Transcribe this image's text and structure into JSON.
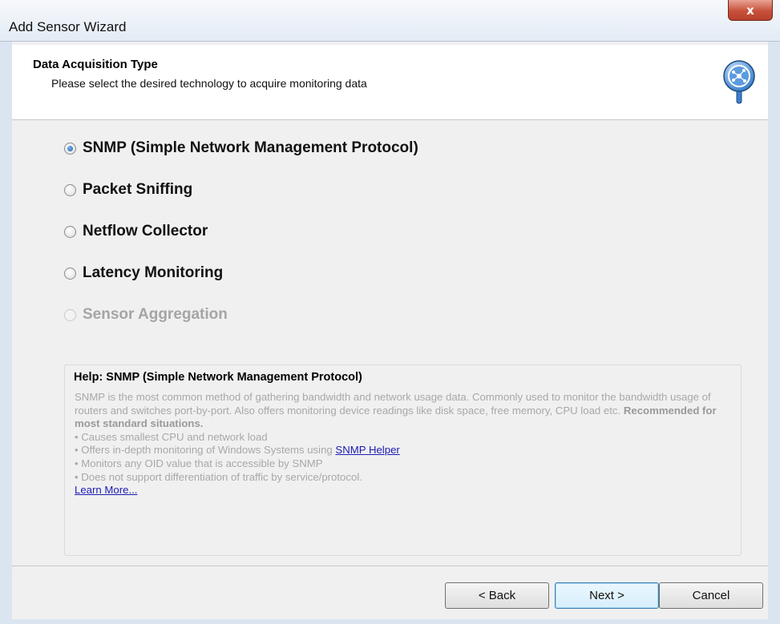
{
  "window": {
    "title": "Add Sensor Wizard",
    "close_label": "x"
  },
  "header": {
    "title": "Data Acquisition Type",
    "subtitle": "Please select the desired technology to acquire monitoring data",
    "icon": "sensor-wizard-icon"
  },
  "options": [
    {
      "label": "SNMP (Simple Network Management Protocol)",
      "checked": true,
      "disabled": false
    },
    {
      "label": "Packet Sniffing",
      "checked": false,
      "disabled": false
    },
    {
      "label": "Netflow Collector",
      "checked": false,
      "disabled": false
    },
    {
      "label": "Latency Monitoring",
      "checked": false,
      "disabled": false
    },
    {
      "label": "Sensor Aggregation",
      "checked": false,
      "disabled": true
    }
  ],
  "help": {
    "title": "Help: SNMP (Simple Network Management Protocol)",
    "intro": "SNMP is the most common method of gathering bandwidth and network usage data. Commonly used to monitor the bandwidth usage of routers and switches port-by-port. Also offers monitoring device readings like disk space, free memory, CPU load etc.",
    "intro_bold": "Recommended for most standard situations.",
    "bullet_1": "Causes smallest CPU and network load",
    "bullet_2_prefix": "Offers in-depth monitoring of Windows Systems using",
    "bullet_2_link": "SNMP Helper",
    "bullet_3": "Monitors any OID value that is accessible by SNMP",
    "bullet_4": "Does not support differentiation of traffic by service/protocol.",
    "learn_more": "Learn More..."
  },
  "buttons": {
    "back": "< Back",
    "next": "Next >",
    "cancel": "Cancel"
  }
}
